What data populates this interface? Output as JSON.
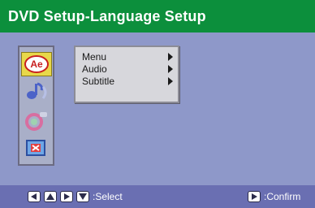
{
  "title": "DVD Setup-Language Setup",
  "sidebar": {
    "items": [
      {
        "icon": "language-icon",
        "active": true,
        "text": "Ae"
      },
      {
        "icon": "audio-speaker-icon",
        "active": false
      },
      {
        "icon": "video-adjust-icon",
        "active": false
      },
      {
        "icon": "exit-icon",
        "active": false
      }
    ]
  },
  "menu": {
    "items": [
      {
        "label": "Menu"
      },
      {
        "label": "Audio"
      },
      {
        "label": "Subtitle"
      }
    ]
  },
  "bottom": {
    "select_label": ":Select",
    "confirm_label": ":Confirm"
  },
  "colors": {
    "title_bg": "#0c8f3c",
    "body_bg": "#8e98c9",
    "bottom_bg": "#6a6fb2",
    "active_icon_bg": "#e8d84a"
  }
}
